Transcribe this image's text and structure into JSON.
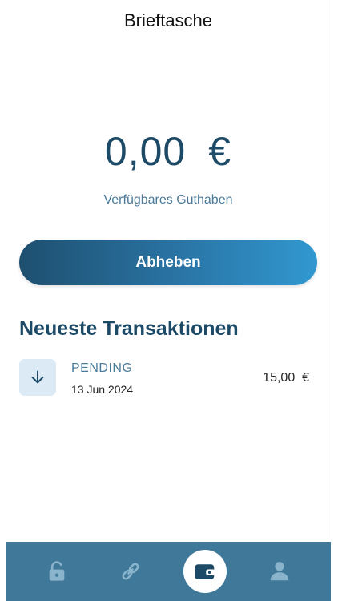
{
  "header": {
    "title": "Brieftasche"
  },
  "balance": {
    "amount": "0,00",
    "currency": "€",
    "label": "Verfügbares Guthaben"
  },
  "actions": {
    "withdraw_label": "Abheben"
  },
  "transactions": {
    "title": "Neueste Transaktionen",
    "items": [
      {
        "status": "PENDING",
        "date": "13 Jun 2024",
        "amount": "15,00  €",
        "icon": "arrow-down-icon"
      }
    ]
  },
  "nav": {
    "items": [
      {
        "icon": "lock-icon"
      },
      {
        "icon": "link-icon"
      },
      {
        "icon": "wallet-icon",
        "active": true
      },
      {
        "icon": "person-icon"
      }
    ]
  },
  "colors": {
    "primary": "#1d4a66",
    "accent": "#3198d0",
    "nav_bg": "#3f7899",
    "icon_bg": "#dbeaf5"
  }
}
